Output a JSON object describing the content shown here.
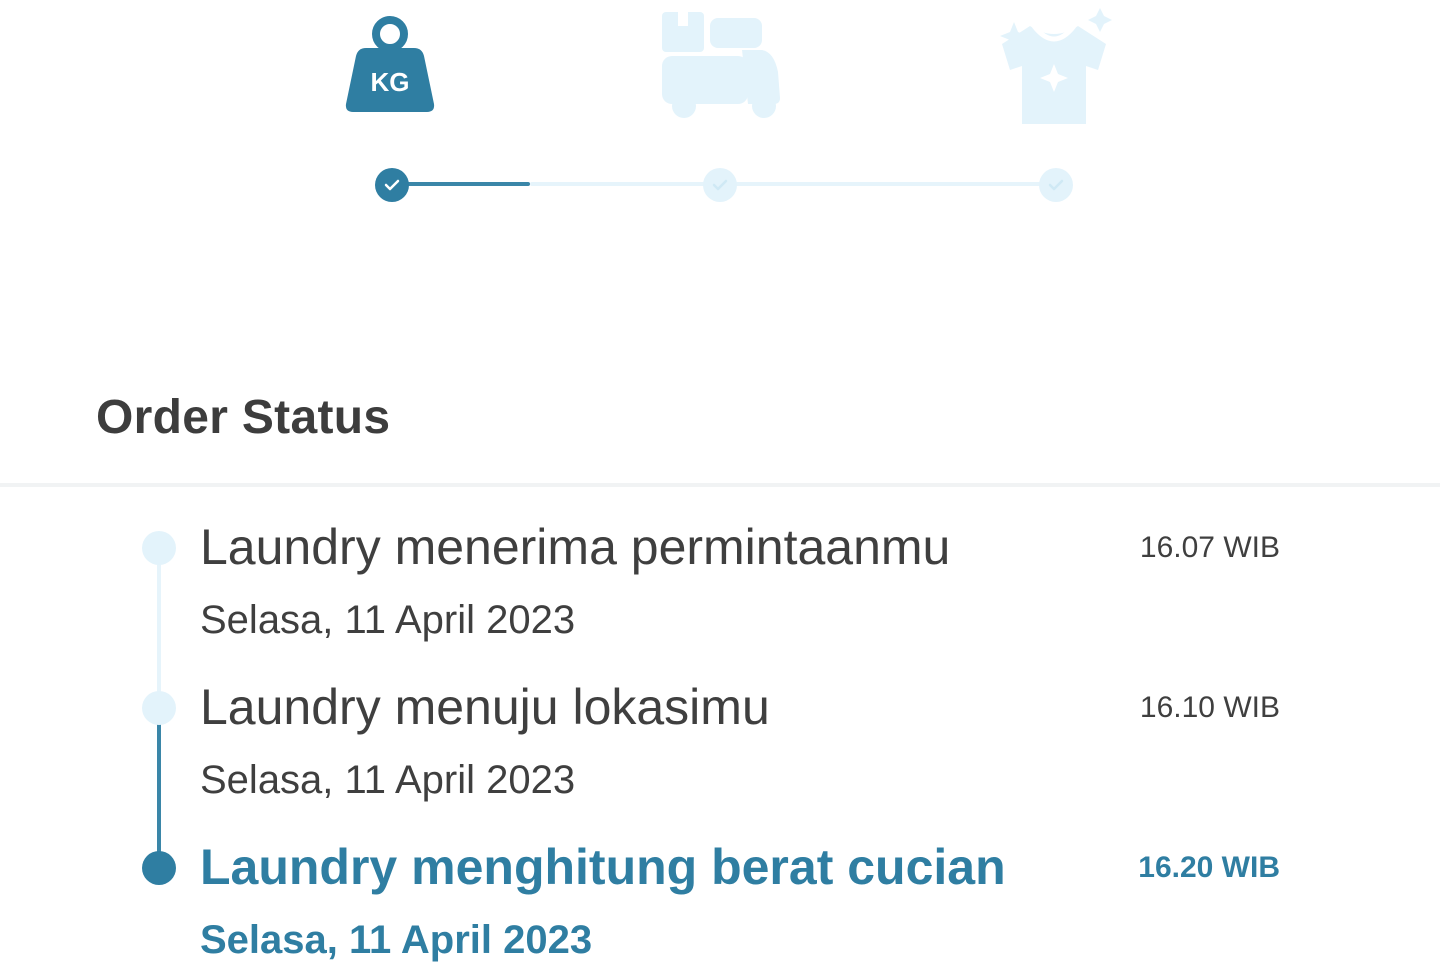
{
  "stepper": {
    "steps": [
      {
        "name": "weigh",
        "icon": "weight-kg-icon",
        "icon_text": "KG",
        "status": "done"
      },
      {
        "name": "delivery",
        "icon": "delivery-scooter-icon",
        "status": "pending"
      },
      {
        "name": "clean",
        "icon": "clean-shirt-icon",
        "status": "pending"
      }
    ],
    "progress_fraction": 0.2
  },
  "order_status": {
    "title": "Order Status",
    "events": [
      {
        "title": "Laundry menerima permintaanmu",
        "date": "Selasa, 11 April 2023",
        "time": "16.07 WIB",
        "active": false
      },
      {
        "title": "Laundry menuju lokasimu",
        "date": "Selasa, 11 April 2023",
        "time": "16.10 WIB",
        "active": false
      },
      {
        "title": "Laundry menghitung berat cucian",
        "date": "Selasa, 11 April 2023",
        "time": "16.20 WIB",
        "active": true
      }
    ]
  },
  "colors": {
    "accent": "#2f7ea2",
    "accent_line": "#3a86a8",
    "inactive": "#e3f3fb",
    "text": "#3f3f3f",
    "divider": "#f1f3f4"
  }
}
